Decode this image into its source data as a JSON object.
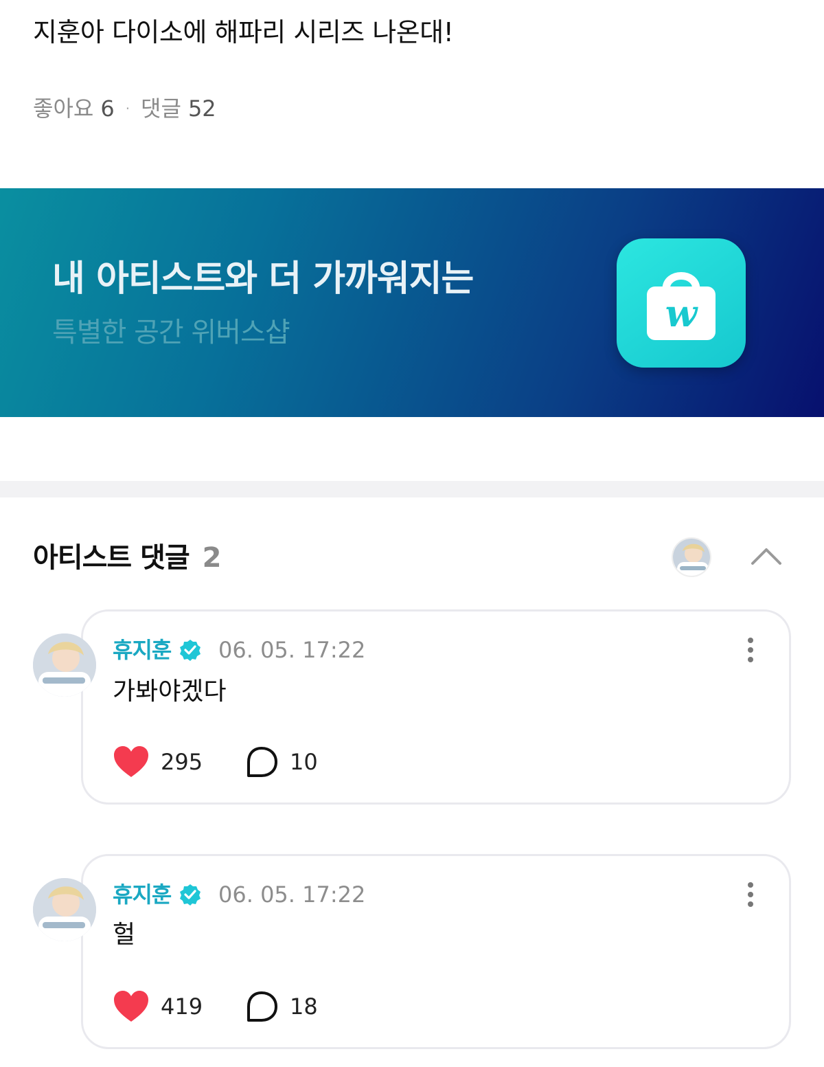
{
  "post": {
    "title": "지훈아 다이소에 해파리 시리즈 나온대!",
    "likes_label": "좋아요",
    "likes_count": "6",
    "separator": "·",
    "comments_label": "댓글",
    "comments_count": "52"
  },
  "banner": {
    "headline": "내 아티스트와 더 가까워지는",
    "subtitle": "특별한 공간 위버스샵",
    "logo_letter": "w",
    "colors": {
      "start": "#0a8fa0",
      "end": "#07106e",
      "logo": "#22d6d8"
    }
  },
  "artist_comments": {
    "title": "아티스트 댓글",
    "count": "2",
    "collapse_icon": "chevron-up-icon",
    "comments": [
      {
        "author": "휴지훈",
        "time": "06. 05. 17:22",
        "text": "가봐야겠다",
        "likes": "295",
        "replies": "10"
      },
      {
        "author": "휴지훈",
        "time": "06. 05. 17:22",
        "text": "헐",
        "likes": "419",
        "replies": "18"
      }
    ]
  },
  "colors": {
    "accent": "#1aa8c2",
    "verified": "#1fc6d6",
    "heart": "#f43b4f"
  }
}
